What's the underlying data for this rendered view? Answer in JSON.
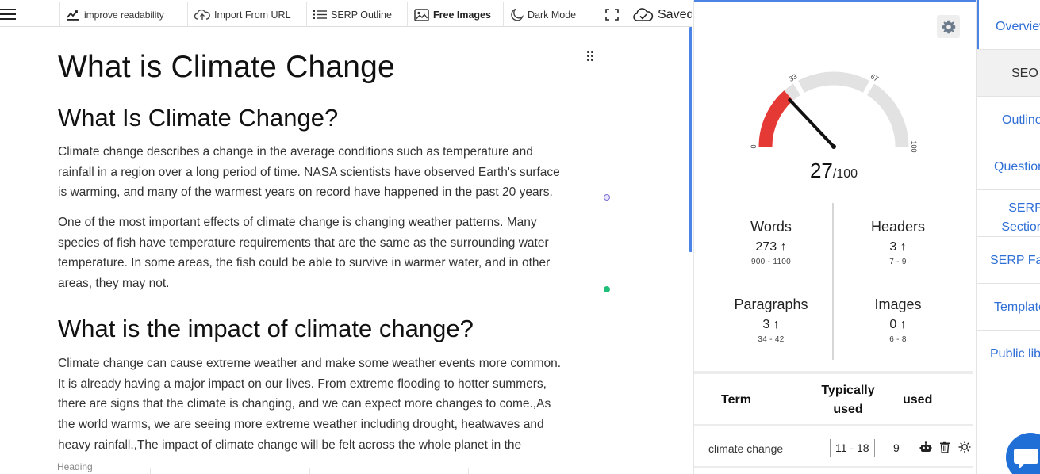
{
  "toolbar": {
    "improve": "improve readability",
    "import": "Import From URL",
    "serp_outline": "SERP Outline",
    "free_images": "Free Images",
    "dark_mode": "Dark Mode",
    "saved": "Saved",
    "icons": [
      "menu-icon",
      "readability-icon",
      "cloud-upload-icon",
      "list-icon",
      "image-icon",
      "moon-icon",
      "fullscreen-icon",
      "cloud-check-icon"
    ]
  },
  "document": {
    "title": "What is Climate Change",
    "section1_heading": "What Is Climate Change?",
    "para1_lines": [
      "Climate change describes a change in the average conditions such as temperature and",
      "rainfall in a region over a long period of time. NASA scientists have observed Earth's surface",
      "is warming, and many of the warmest years on record have happened in the past 20 years."
    ],
    "para2_lines": [
      "One of the most important effects of climate change is changing weather patterns.  Many",
      "species of fish have temperature requirements that are the same as the surrounding water",
      "temperature.  In some areas, the fish could be able to survive in warmer water, and in other",
      "areas, they may not."
    ],
    "section2_heading": "What is the impact of climate change?",
    "para3_lines": [
      "Climate change can cause extreme weather and make some weather events more common.",
      "It is already having a major impact on our lives. From extreme flooding to hotter summers,",
      "there are signs that the climate is changing, and we can expect more changes to come.,As",
      "the world warms, we are seeing more extreme weather including drought, heatwaves and",
      "heavy rainfall.,The impact of climate change will be felt across the whole planet in the"
    ]
  },
  "statusbar": {
    "block_type": "Heading"
  },
  "score": {
    "value": 27,
    "max": "/100",
    "gauge_ticks": [
      "0",
      "33",
      "67",
      "100"
    ],
    "colors": {
      "low": "#e53935",
      "track": "#e2e2e2",
      "needle": "#111111"
    }
  },
  "stats": {
    "words": {
      "title": "Words",
      "value": "273",
      "range": "900 - 1100"
    },
    "headers": {
      "title": "Headers",
      "value": "3",
      "range": "7 - 9"
    },
    "paragraphs": {
      "title": "Paragraphs",
      "value": "3",
      "range": "34 - 42"
    },
    "images": {
      "title": "Images",
      "value": "0",
      "range": "6 - 8"
    }
  },
  "terms": {
    "header": {
      "term": "Term",
      "typically_line1": "Typically",
      "typically_line2": "used",
      "used": "used"
    },
    "rows": [
      {
        "term": "climate change",
        "range": "11 - 18",
        "used": "9"
      }
    ]
  },
  "nav": {
    "items": [
      "Overview",
      "SEO",
      "Outline",
      "Questions",
      "SERP Sections",
      "SERP Facts",
      "Templates",
      "Public library"
    ],
    "active": "SEO"
  },
  "accent_color": "#4c84e6"
}
